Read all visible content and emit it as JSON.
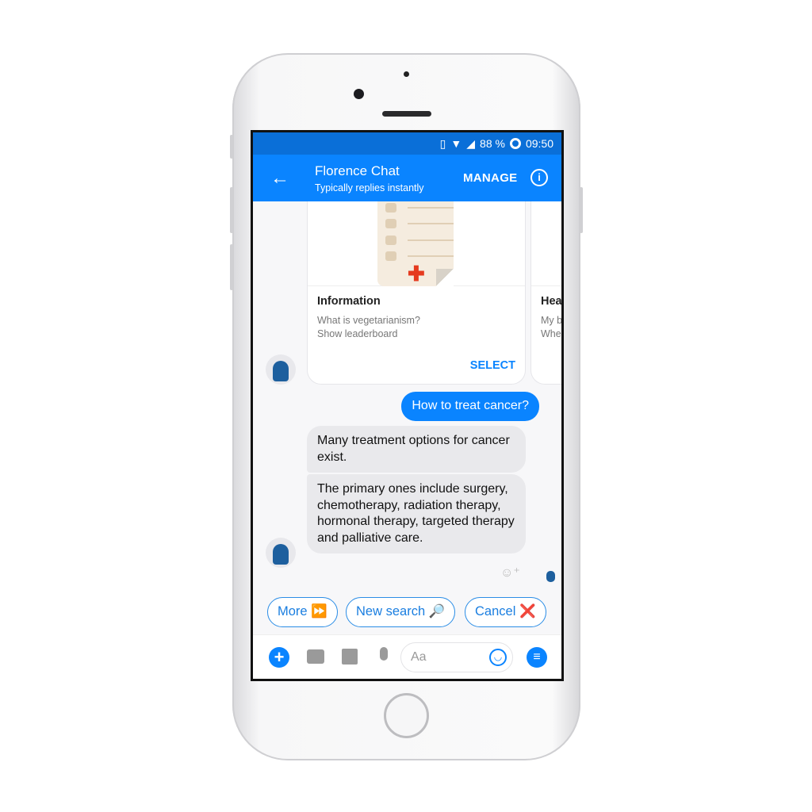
{
  "status_bar": {
    "battery": "88 %",
    "time": "09:50"
  },
  "header": {
    "title": "Florence Chat",
    "subtitle": "Typically replies instantly",
    "manage_label": "MANAGE"
  },
  "cards": [
    {
      "title": "Information",
      "lines": [
        "What is vegetarianism?",
        "Show leaderboard"
      ],
      "action": "SELECT"
    },
    {
      "title": "Hea",
      "lines": [
        "My b",
        "Whe"
      ]
    }
  ],
  "messages": [
    {
      "from": "user",
      "text": "How to treat cancer?"
    },
    {
      "from": "bot",
      "text": "Many treatment options for cancer exist."
    },
    {
      "from": "bot",
      "text": "The primary ones include surgery, chemotherapy, radiation therapy, hormonal therapy, targeted therapy and palliative care."
    }
  ],
  "quick_replies": [
    "More ⏩",
    "New search 🔎",
    "Cancel ❌"
  ],
  "composer": {
    "placeholder": "Aa"
  },
  "colors": {
    "accent": "#0a84ff",
    "status_bar": "#0a6fd8",
    "bot_bubble": "#e9e9ec"
  }
}
